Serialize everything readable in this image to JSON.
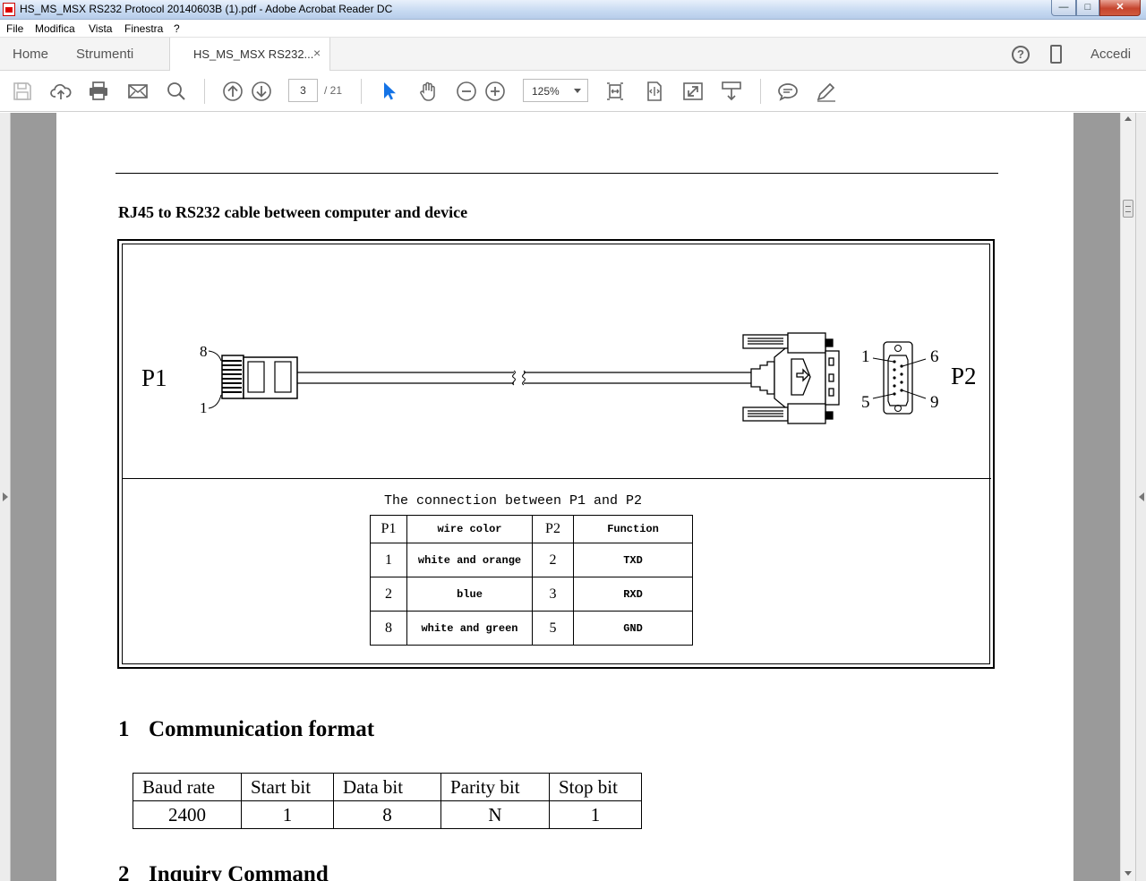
{
  "window": {
    "title": "HS_MS_MSX RS232 Protocol 20140603B (1).pdf - Adobe Acrobat Reader DC",
    "controls": {
      "minimize": "—",
      "maximize": "□",
      "close": "✕"
    }
  },
  "menu": [
    "File",
    "Modifica",
    "Vista",
    "Finestra",
    "?"
  ],
  "tabs": {
    "home": "Home",
    "tools": "Strumenti",
    "document": "HS_MS_MSX RS232...",
    "close_glyph": "×",
    "help_glyph": "?",
    "sign_in": "Accedi"
  },
  "toolbar": {
    "page_current": "3",
    "page_total": "/ 21",
    "zoom": "125%",
    "icons": [
      "save-icon",
      "upload-cloud-icon",
      "print-icon",
      "email-icon",
      "search-icon",
      "prev-page-icon",
      "next-page-icon",
      "select-cursor-icon",
      "hand-tool-icon",
      "zoom-out-icon",
      "zoom-in-icon",
      "fit-width-icon",
      "fit-page-icon",
      "fullscreen-icon",
      "scroll-mode-icon",
      "comment-icon",
      "highlight-pen-icon"
    ]
  },
  "document": {
    "section_heading": "RJ45 to RS232 cable between computer and device",
    "figure": {
      "p1_label": "P1",
      "p2_label": "P2",
      "pin_labels_left": [
        "8",
        "1"
      ],
      "pin_labels_right": [
        "1",
        "6",
        "5",
        "9"
      ],
      "caption": "The connection between P1 and P2",
      "table": {
        "headers": [
          "P1",
          "wire color",
          "P2",
          "Function"
        ],
        "rows": [
          [
            "1",
            "white and orange",
            "2",
            "TXD"
          ],
          [
            "2",
            "blue",
            "3",
            "RXD"
          ],
          [
            "8",
            "white and green",
            "5",
            "GND"
          ]
        ]
      }
    },
    "comm_heading": {
      "number": "1",
      "text": "Communication format"
    },
    "comm_table": {
      "headers": [
        "Baud rate",
        "Start bit",
        "Data bit",
        "Parity bit",
        "Stop bit"
      ],
      "values": [
        "2400",
        "1",
        "8",
        "N",
        "1"
      ]
    },
    "inquiry_heading": {
      "number": "2",
      "text": "Inquiry Command"
    }
  }
}
